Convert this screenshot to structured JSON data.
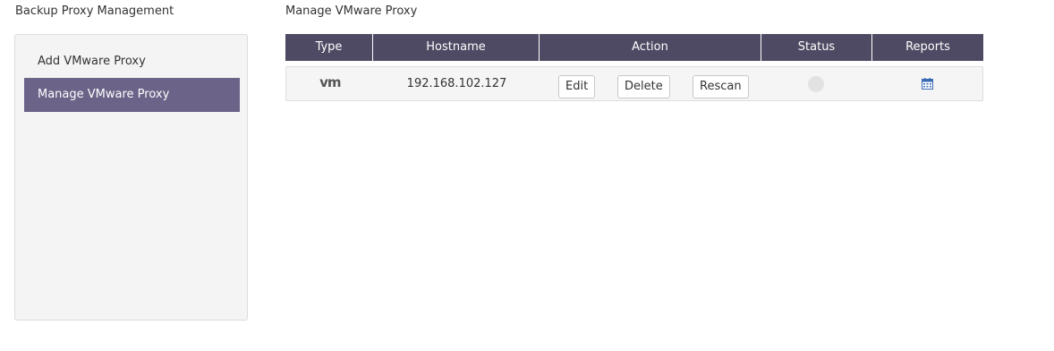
{
  "sidebar": {
    "title": "Backup Proxy Management",
    "items": [
      {
        "label": "Add VMware Proxy",
        "active": false
      },
      {
        "label": "Manage VMware Proxy",
        "active": true
      }
    ]
  },
  "main": {
    "title": "Manage VMware Proxy",
    "columns": [
      "Type",
      "Hostname",
      "Action",
      "Status",
      "Reports"
    ],
    "rows": [
      {
        "type_logo": "vm",
        "hostname": "192.168.102.127",
        "actions": [
          "Edit",
          "Delete",
          "Rescan"
        ],
        "status_icon": "status-dot-grey",
        "reports_icon": "calendar-icon"
      }
    ]
  },
  "colors": {
    "accent": "#6b6388",
    "header_bg": "#4e4a63",
    "calendar_icon": "#3a6bb5",
    "status_dot": "#e2e2e2"
  }
}
